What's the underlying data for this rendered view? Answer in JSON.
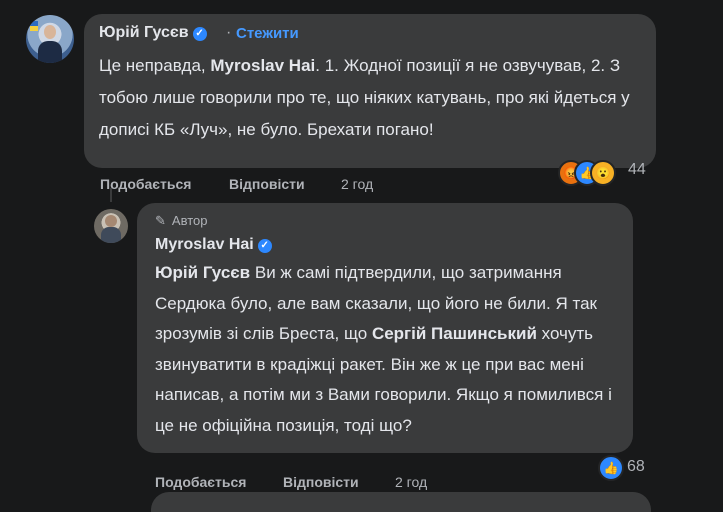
{
  "comment1": {
    "author": "Юрій Гусєв",
    "follow": "Стежити",
    "text_parts": [
      {
        "t": "Це неправда, "
      },
      {
        "t": "Myroslav Hai",
        "b": true
      },
      {
        "t": ". 1. Жодної позиції я не озвучував, 2. З тобою лише говорили про те, що ніяких катувань, про які йдеться у дописі КБ «Луч», не було. Брехати погано!"
      }
    ],
    "reaction_count": "44",
    "reactions": [
      "angry-emoji",
      "like-emoji",
      "wow-emoji"
    ],
    "actions": {
      "like": "Подобається",
      "reply": "Відповісти",
      "time": "2 год"
    }
  },
  "comment2": {
    "badge": "Автор",
    "author": "Myroslav Hai",
    "text_parts": [
      {
        "t": "Юрій Гусєв",
        "b": true
      },
      {
        "t": " Ви ж самі підтвердили, що затримання Сердюка було, але вам сказали, що його не били. Я так зрозумів зі слів Бреста, що "
      },
      {
        "t": "Сергій Пашинський",
        "b": true
      },
      {
        "t": " хочуть звинуватити в крадіжці ракет. Він же ж це при вас мені написав, а потім ми з Вами говорили. Якщо я помилився і це не офіційна позиція, тоді що?"
      }
    ],
    "reaction_count": "68",
    "reactions": [
      "like-emoji"
    ],
    "actions": {
      "like": "Подобається",
      "reply": "Відповісти",
      "time": "2 год"
    }
  },
  "colors": {
    "background": "#18191a",
    "bubble": "#3a3b3c",
    "text": "#e4e6eb",
    "secondary": "#b0b3b8",
    "link": "#4599ff",
    "verified": "#2d88ff"
  }
}
